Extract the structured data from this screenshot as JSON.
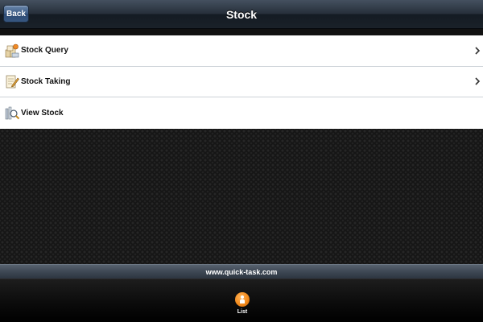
{
  "navbar": {
    "back_label": "Back",
    "title": "Stock"
  },
  "menu": {
    "items": [
      {
        "label": "Stock Query",
        "icon": "stock-query-icon",
        "has_chevron": true
      },
      {
        "label": "Stock Taking",
        "icon": "stock-taking-icon",
        "has_chevron": true
      },
      {
        "label": "View Stock",
        "icon": "view-stock-icon",
        "has_chevron": false
      }
    ]
  },
  "footer": {
    "website": "www.quick-task.com"
  },
  "tabbar": {
    "tabs": [
      {
        "label": "List",
        "icon": "list-icon",
        "active": true
      }
    ]
  },
  "colors": {
    "navbar": "#27303b",
    "back_button": "#3e5d86",
    "tab_accent": "#f28a1c",
    "list_background": "#ffffff"
  }
}
